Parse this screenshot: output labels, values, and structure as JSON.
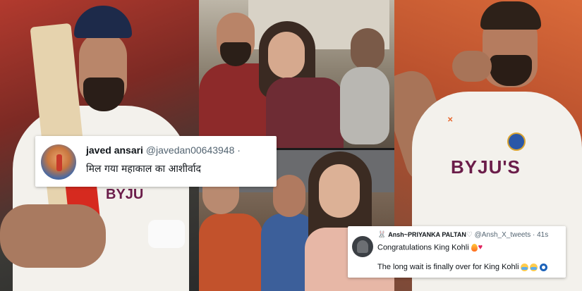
{
  "tweets": [
    {
      "name": "javed ansari",
      "handle": "@javedan00643948 ·",
      "text": "मिल गया महाकाल का आशीर्वाद"
    },
    {
      "prefix_emoji": "🐰",
      "name": "Ansh~PRIYANKA PALTAN",
      "name_suffix": "♡",
      "handle": "@Ansh_X_tweets · 41s",
      "line1": "Congratulations King Kohli",
      "line2": "The long wait is finally over for King Kohli"
    }
  ],
  "photos": [
    {
      "name": "left",
      "subject": "cricketer holding bat in white test kit and blue cap"
    },
    {
      "name": "middle-top",
      "subject": "couple at temple in shawls"
    },
    {
      "name": "middle-bottom",
      "subject": "couple seated at temple with priest"
    },
    {
      "name": "right",
      "subject": "cricketer kissing chain in white test kit"
    }
  ],
  "jersey_text": {
    "right_logo": "BYJU'S",
    "left_logo": "BYJU"
  },
  "colors": {
    "tweet_bg": "#ffffff",
    "text_primary": "#0f1419",
    "text_secondary": "#536471",
    "jersey_logo": "#6b1d4a"
  }
}
